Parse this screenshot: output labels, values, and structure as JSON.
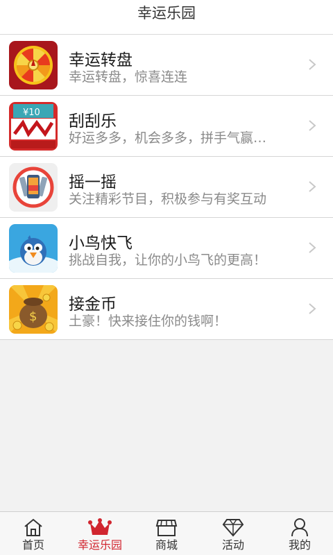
{
  "header": {
    "title": "幸运乐园"
  },
  "games": [
    {
      "title": "幸运转盘",
      "desc": "幸运转盘，惊喜连连",
      "icon": "wheel-icon"
    },
    {
      "title": "刮刮乐",
      "desc": "好运多多，机会多多，拼手气赢…",
      "icon": "scratch-card-icon"
    },
    {
      "title": "摇一摇",
      "desc": "关注精彩节目，积极参与有奖互动",
      "icon": "shake-phone-icon"
    },
    {
      "title": "小鸟快飞",
      "desc": "挑战自我，让你的小鸟飞的更高！",
      "icon": "bird-icon"
    },
    {
      "title": "接金币",
      "desc": "土豪！快来接住你的钱啊！",
      "icon": "gold-coins-icon"
    }
  ],
  "icon_labels": {
    "scratch_card_text": "¥10"
  },
  "tabs": [
    {
      "label": "首页",
      "icon": "home-icon"
    },
    {
      "label": "幸运乐园",
      "icon": "crown-icon",
      "active": true
    },
    {
      "label": "商城",
      "icon": "shop-icon"
    },
    {
      "label": "活动",
      "icon": "diamond-icon"
    },
    {
      "label": "我的",
      "icon": "user-icon"
    }
  ],
  "colors": {
    "accent": "#d1252f",
    "tab_inactive": "#333333",
    "desc": "#8a8a8a"
  }
}
